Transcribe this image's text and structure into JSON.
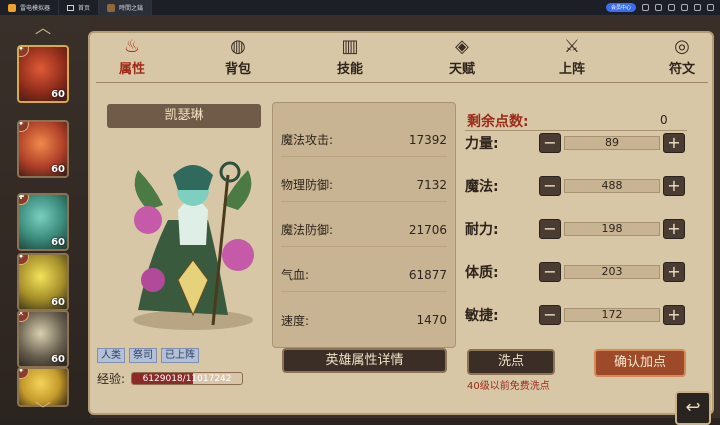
{
  "emulator": {
    "tabs": [
      {
        "label": "雷电模拟器"
      },
      {
        "label": "首页"
      },
      {
        "label": "時間之鑰"
      }
    ],
    "vip_label": "会员中心"
  },
  "tabs": [
    {
      "label": "属性",
      "icon": "attribute-icon"
    },
    {
      "label": "背包",
      "icon": "bag-icon"
    },
    {
      "label": "技能",
      "icon": "book-icon"
    },
    {
      "label": "天赋",
      "icon": "talent-icon"
    },
    {
      "label": "上阵",
      "icon": "swords-icon"
    },
    {
      "label": "符文",
      "icon": "rune-icon"
    }
  ],
  "heroes": [
    {
      "level": "60",
      "class_icon": "✦"
    },
    {
      "level": "60",
      "class_icon": "✦"
    },
    {
      "level": "60",
      "class_icon": "✚"
    },
    {
      "level": "60",
      "class_icon": "✦"
    },
    {
      "level": "60",
      "class_icon": "✕"
    },
    {
      "level": "",
      "class_icon": "✦"
    }
  ],
  "hero": {
    "name": "凯瑟琳",
    "tags": [
      "人类",
      "祭司",
      "已上阵"
    ],
    "exp_label": "经验:",
    "exp_value": "6129018/11017242",
    "exp_fraction": 0.556
  },
  "stats": [
    {
      "label": "魔法攻击:",
      "value": "17392"
    },
    {
      "label": "物理防御:",
      "value": "7132"
    },
    {
      "label": "魔法防御:",
      "value": "21706"
    },
    {
      "label": "气血:",
      "value": "61877"
    },
    {
      "label": "速度:",
      "value": "1470"
    }
  ],
  "detail_button": "英雄属性详情",
  "allocation": {
    "points_label": "剩余点数:",
    "points_value": "0",
    "attributes": [
      {
        "name": "力量:",
        "value": "89"
      },
      {
        "name": "魔法:",
        "value": "488"
      },
      {
        "name": "耐力:",
        "value": "198"
      },
      {
        "name": "体质:",
        "value": "203"
      },
      {
        "name": "敏捷:",
        "value": "172"
      }
    ],
    "wash_button": "洗点",
    "wash_note": "40级以前免费洗点",
    "confirm_button": "确认加点"
  },
  "colors": {
    "accent_red": "#9a2a1a",
    "parchment": "#d8c7a6",
    "dark_button": "#3a2e26"
  }
}
